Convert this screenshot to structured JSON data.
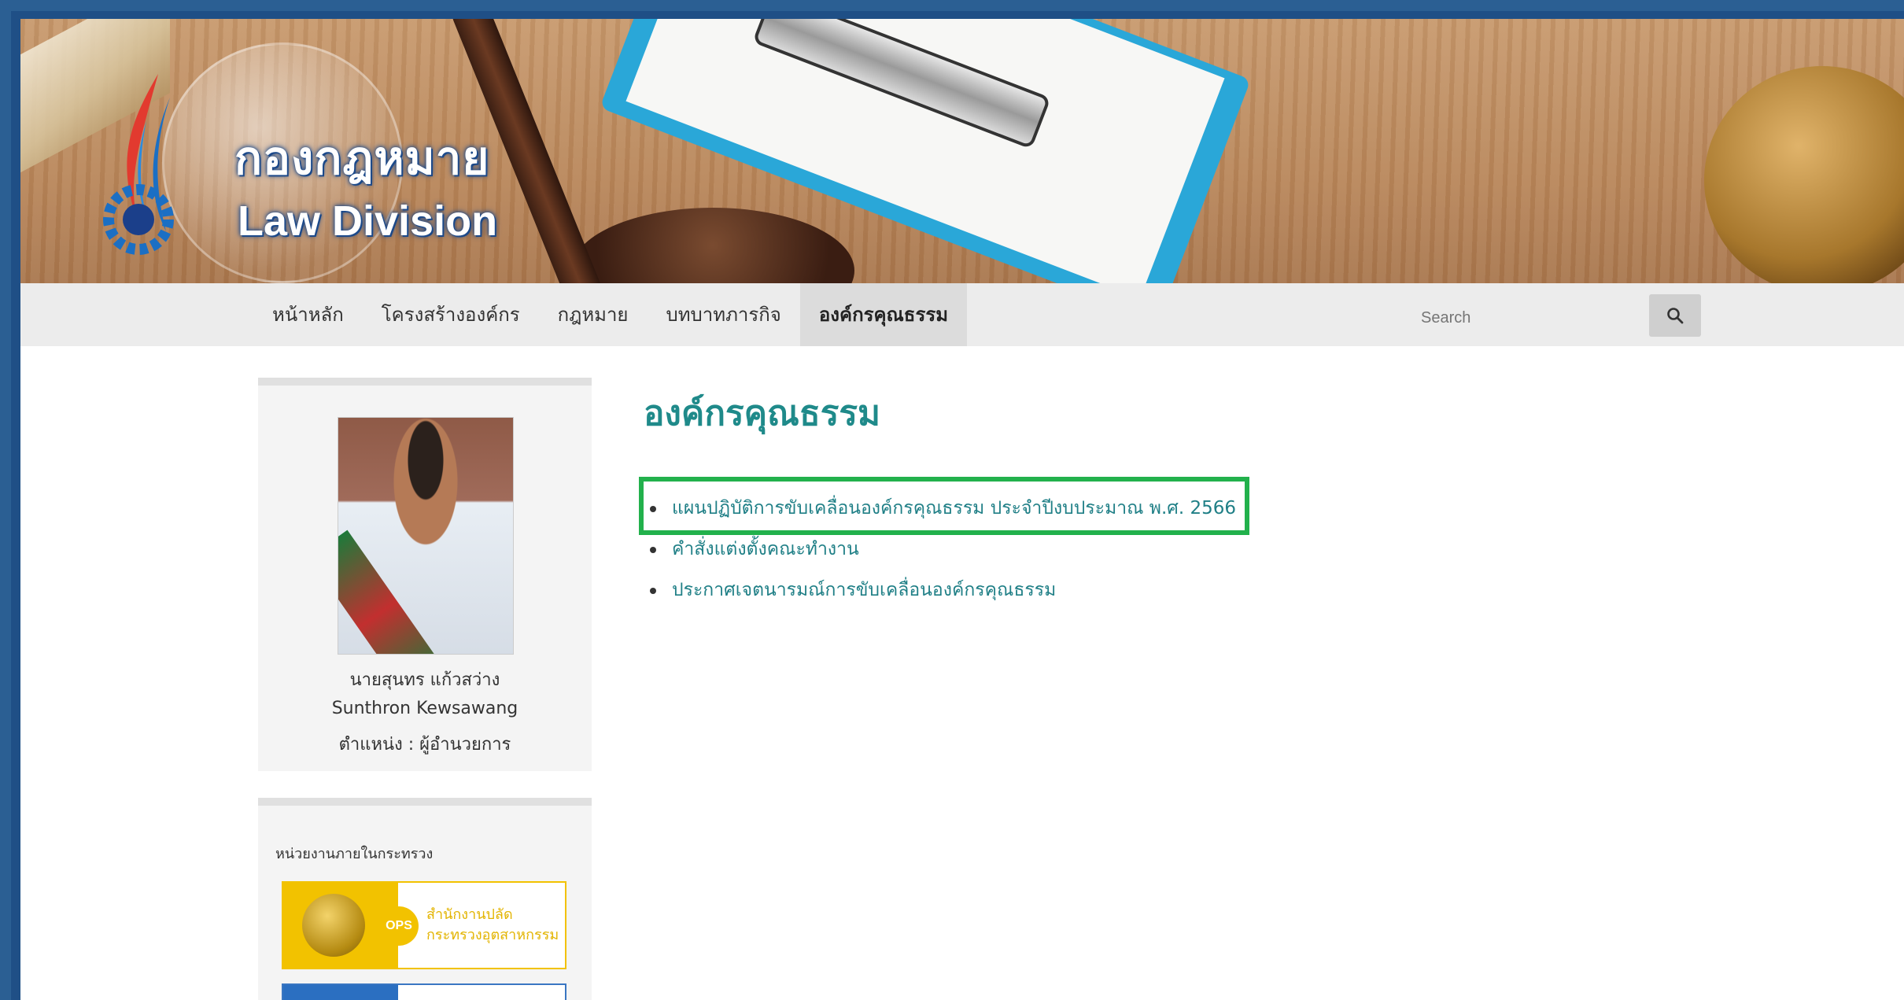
{
  "brand": {
    "name_th": "กองกฎหมาย",
    "name_en": "Law Division"
  },
  "nav": {
    "items": [
      {
        "label": "หน้าหลัก"
      },
      {
        "label": "โครงสร้างองค์กร"
      },
      {
        "label": "กฎหมาย"
      },
      {
        "label": "บทบาทภารกิจ"
      },
      {
        "label": "องค์กรคุณธรรม"
      }
    ],
    "active_index": 4,
    "search_placeholder": "Search"
  },
  "profile": {
    "name_th": "นายสุนทร แก้วสว่าง",
    "name_en": "Sunthron Kewsawang",
    "position": "ตำแหน่ง : ผู้อำนวยการ"
  },
  "links_panel": {
    "title": "หน่วยงานภายในกระทรวง",
    "ops_badge": "OPS",
    "ops_line1": "สำนักงานปลัด",
    "ops_line2": "กระทรวงอุตสาหกรรม"
  },
  "main": {
    "title": "องค์กรคุณธรรม",
    "items": [
      {
        "label": "แผนปฏิบัติการขับเคลื่อนองค์กรคุณธรรม ประจำปีงบประมาณ พ.ศ. 2566"
      },
      {
        "label": "คำสั่งแต่งตั้งคณะทำงาน"
      },
      {
        "label": "ประกาศเจตนารมณ์การขับเคลื่อนองค์กรคุณธรรม"
      }
    ]
  },
  "colors": {
    "accent_teal": "#1f8a8a",
    "highlight_green": "#22b14c",
    "frame_blue": "#1f4f86"
  }
}
